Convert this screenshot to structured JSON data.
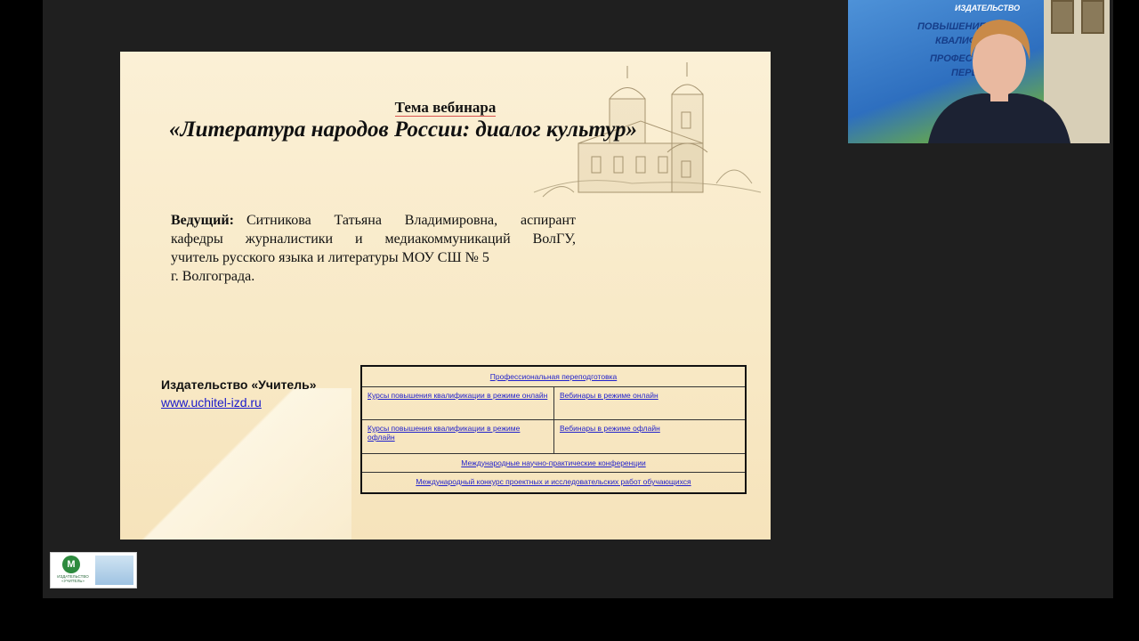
{
  "slide": {
    "topic_label": "Тема вебинара",
    "topic_title": "«Литература народов России: диалог культур»",
    "host_label": "Ведущий:",
    "host_line1": "Ситникова Татьяна Владимировна, аспирант",
    "host_line2": "кафедры журналистики и медиакоммуникаций ВолГУ,",
    "host_line3": "учитель русского языка и литературы МОУ СШ № 5",
    "host_line4": "г. Волгограда.",
    "publisher_name": "Издательство «Учитель»",
    "publisher_url": "www.uchitel-izd.ru",
    "links": {
      "retraining": "Профессиональная переподготовка",
      "courses_online": "Курсы повышения квалификации в режиме онлайн",
      "webinars_online": "Вебинары в режиме онлайн",
      "courses_offline": "Курсы повышения квалификации в режиме офлайн",
      "webinars_offline": "Вебинары в режиме офлайн",
      "conferences": "Международные научно-практические конференции",
      "contest": "Международный конкурс проектных и исследовательских работ обучающихся"
    }
  },
  "webcam": {
    "banner_line1": "ИЗДАТЕЛЬСТВО",
    "banner_line2": "ПОВЫШЕНИЕ",
    "banner_line3": "КВАЛИФ",
    "banner_line4": "ПРОФЕССИО",
    "banner_line5": "ПЕРЕПОД"
  },
  "logo": {
    "letter": "М",
    "caption": "ИЗДАТЕЛЬСТВО «УЧИТЕЛЬ»"
  },
  "colors": {
    "slide_bg": "#fbf0d6",
    "link": "#2222cc",
    "stage_bg": "#1f1f1f"
  }
}
